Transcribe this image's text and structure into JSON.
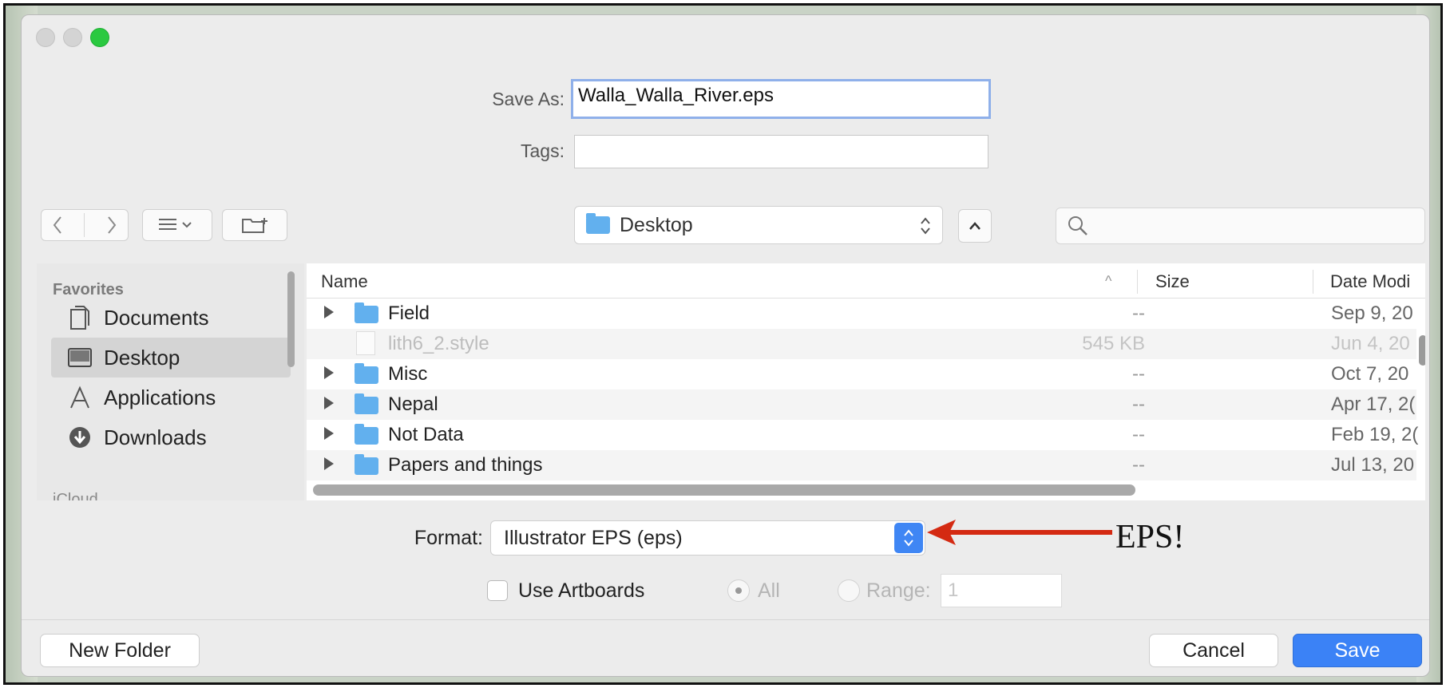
{
  "dialog": {
    "save_as_label": "Save As:",
    "save_as_value": "Walla_Walla_River.eps",
    "tags_label": "Tags:",
    "tags_value": ""
  },
  "toolbar": {
    "location": "Desktop",
    "search_placeholder": ""
  },
  "sidebar": {
    "heading": "Favorites",
    "items": [
      {
        "label": "Documents",
        "icon": "documents-icon"
      },
      {
        "label": "Desktop",
        "icon": "desktop-icon",
        "selected": true
      },
      {
        "label": "Applications",
        "icon": "applications-icon"
      },
      {
        "label": "Downloads",
        "icon": "downloads-icon"
      }
    ],
    "next_heading_partial": "iCloud"
  },
  "file_list": {
    "columns": {
      "name": "Name",
      "size": "Size",
      "date": "Date Modi"
    },
    "rows": [
      {
        "name": "Field",
        "type": "folder",
        "size": "--",
        "date": "Sep 9, 20"
      },
      {
        "name": "lith6_2.style",
        "type": "file",
        "size": "545 KB",
        "date": "Jun 4, 20",
        "disabled": true
      },
      {
        "name": "Misc",
        "type": "folder",
        "size": "--",
        "date": "Oct 7, 20"
      },
      {
        "name": "Nepal",
        "type": "folder",
        "size": "--",
        "date": "Apr 17, 2("
      },
      {
        "name": "Not Data",
        "type": "folder",
        "size": "--",
        "date": "Feb 19, 2("
      },
      {
        "name": "Papers and things",
        "type": "folder",
        "size": "--",
        "date": "Jul 13, 20"
      }
    ]
  },
  "options": {
    "format_label": "Format:",
    "format_value": "Illustrator EPS (eps)",
    "use_artboards_label": "Use Artboards",
    "all_label": "All",
    "range_label": "Range:",
    "range_value": "1"
  },
  "buttons": {
    "new_folder": "New Folder",
    "cancel": "Cancel",
    "save": "Save"
  },
  "annotation": {
    "text": "EPS!",
    "arrow_color": "#d42a12"
  },
  "colors": {
    "accent": "#3b82f6",
    "folder": "#62b0ee",
    "green_light": "#2ac940"
  }
}
